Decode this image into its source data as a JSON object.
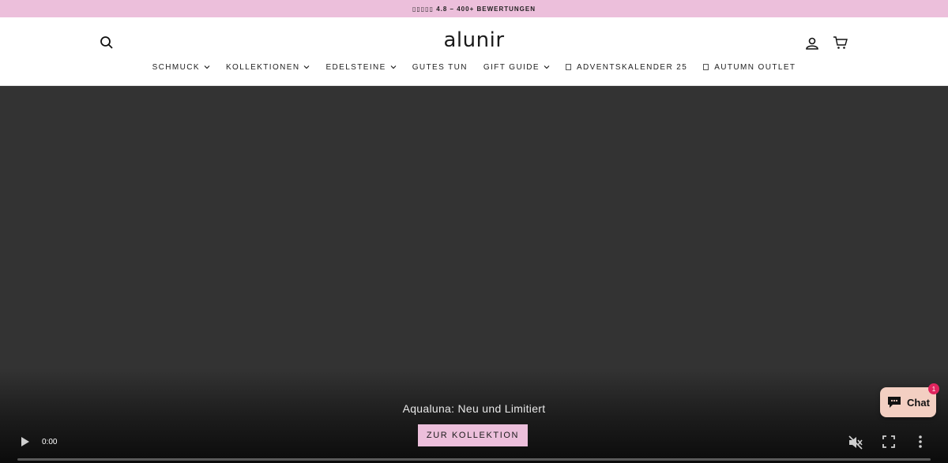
{
  "announcement": {
    "text": "▯▯▯▯▯ 4.8 – 400+ BEWERTUNGEN"
  },
  "header": {
    "logo": "alunir",
    "icons": {
      "search": "search-icon",
      "account": "account-icon",
      "cart": "cart-icon"
    }
  },
  "nav": {
    "items": [
      {
        "label": "SCHMUCK",
        "dropdown": true
      },
      {
        "label": "KOLLEKTIONEN",
        "dropdown": true
      },
      {
        "label": "EDELSTEINE",
        "dropdown": true
      },
      {
        "label": "GUTES TUN",
        "dropdown": false
      },
      {
        "label": "GIFT GUIDE",
        "dropdown": true
      },
      {
        "label": "ADVENTSKALENDER 25",
        "dropdown": false,
        "prefix_icon": true
      },
      {
        "label": "AUTUMN OUTLET",
        "dropdown": false,
        "prefix_icon": true
      }
    ]
  },
  "hero": {
    "title": "Aqualuna: Neu und Limitiert",
    "cta_label": "ZUR KOLLEKTION"
  },
  "video": {
    "time": "0:00",
    "progress": 0
  },
  "chat": {
    "label": "Chat",
    "badge": "1"
  },
  "colors": {
    "accent_pink": "#ecbfdb",
    "hero_bg": "#333333",
    "chat_bg": "#f3cfc2",
    "badge": "#e0245e"
  }
}
